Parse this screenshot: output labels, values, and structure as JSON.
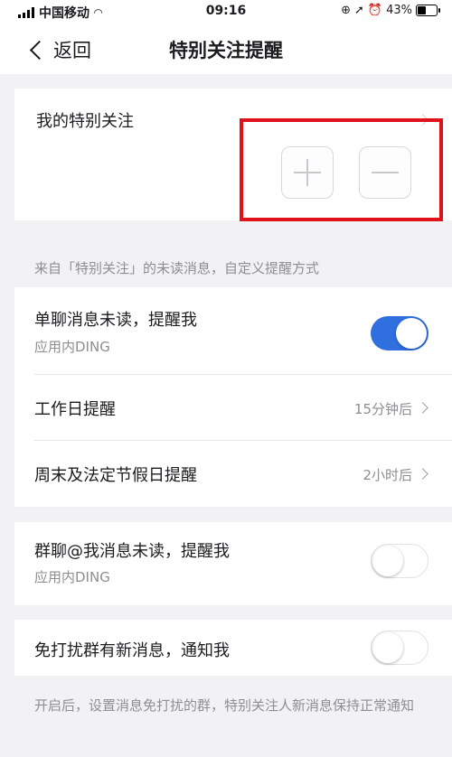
{
  "status_bar": {
    "carrier": "中国移动",
    "time": "09:16",
    "battery": "43%"
  },
  "nav": {
    "back_label": "返回",
    "title": "特别关注提醒"
  },
  "special_follow": {
    "label": "我的特别关注"
  },
  "section_note": "来自「特别关注」的未读消息，自定义提醒方式",
  "settings": {
    "single_chat": {
      "title": "单聊消息未读，提醒我",
      "subtitle": "应用内DING",
      "enabled": true
    },
    "workday": {
      "title": "工作日提醒",
      "value": "15分钟后"
    },
    "weekend": {
      "title": "周末及法定节假日提醒",
      "value": "2小时后"
    },
    "group_chat": {
      "title": "群聊@我消息未读，提醒我",
      "subtitle": "应用内DING",
      "enabled": false
    },
    "dnd_group": {
      "title": "免打扰群有新消息，通知我",
      "enabled": false
    }
  },
  "footnote": "开启后，设置消息免打扰的群，特别关注人新消息保持正常通知",
  "colors": {
    "accent": "#2f6fe0",
    "highlight_box": "#e0111b"
  }
}
